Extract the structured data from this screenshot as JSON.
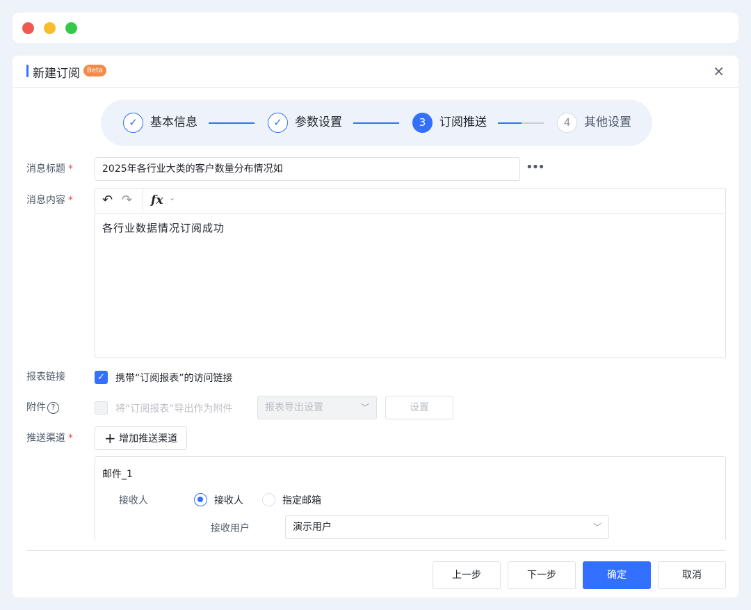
{
  "dialog": {
    "title": "新建订阅",
    "badge": "Beta",
    "close_icon": "×"
  },
  "steps": [
    {
      "label": "基本信息",
      "state": "done",
      "marker": "✓"
    },
    {
      "label": "参数设置",
      "state": "done",
      "marker": "✓"
    },
    {
      "label": "订阅推送",
      "state": "active",
      "marker": "3"
    },
    {
      "label": "其他设置",
      "state": "todo",
      "marker": "4"
    }
  ],
  "form": {
    "title_label": "消息标题",
    "title_value": "2025年各行业大类的客户数量分布情况如",
    "more_icon": "•••",
    "content_label": "消息内容",
    "content_value": "各行业数据情况订阅成功",
    "editor": {
      "undo": "↶",
      "redo": "↷",
      "fx": "fx",
      "caret": "⌄"
    },
    "link_label": "报表链接",
    "link_checkbox_text": "携带“订阅报表”的访问链接",
    "attach_label": "附件",
    "attach_help": "?",
    "attach_checkbox_text": "将“订阅报表”导出作为附件",
    "export_select": "报表导出设置",
    "settings_button": "设置",
    "channel_label": "推送渠道",
    "add_channel_button": "增加推送渠道",
    "required_mark": "*"
  },
  "channel": {
    "name": "邮件_1",
    "recipient_label": "接收人",
    "radio_recipient": "接收人",
    "radio_email": "指定邮箱",
    "users_label": "接收用户",
    "users_value": "演示用户"
  },
  "footer": {
    "prev": "上一步",
    "next": "下一步",
    "confirm": "确定",
    "cancel": "取消"
  },
  "colors": {
    "accent": "#3370ff",
    "badge": "#f28b48",
    "required": "#f54a45"
  }
}
